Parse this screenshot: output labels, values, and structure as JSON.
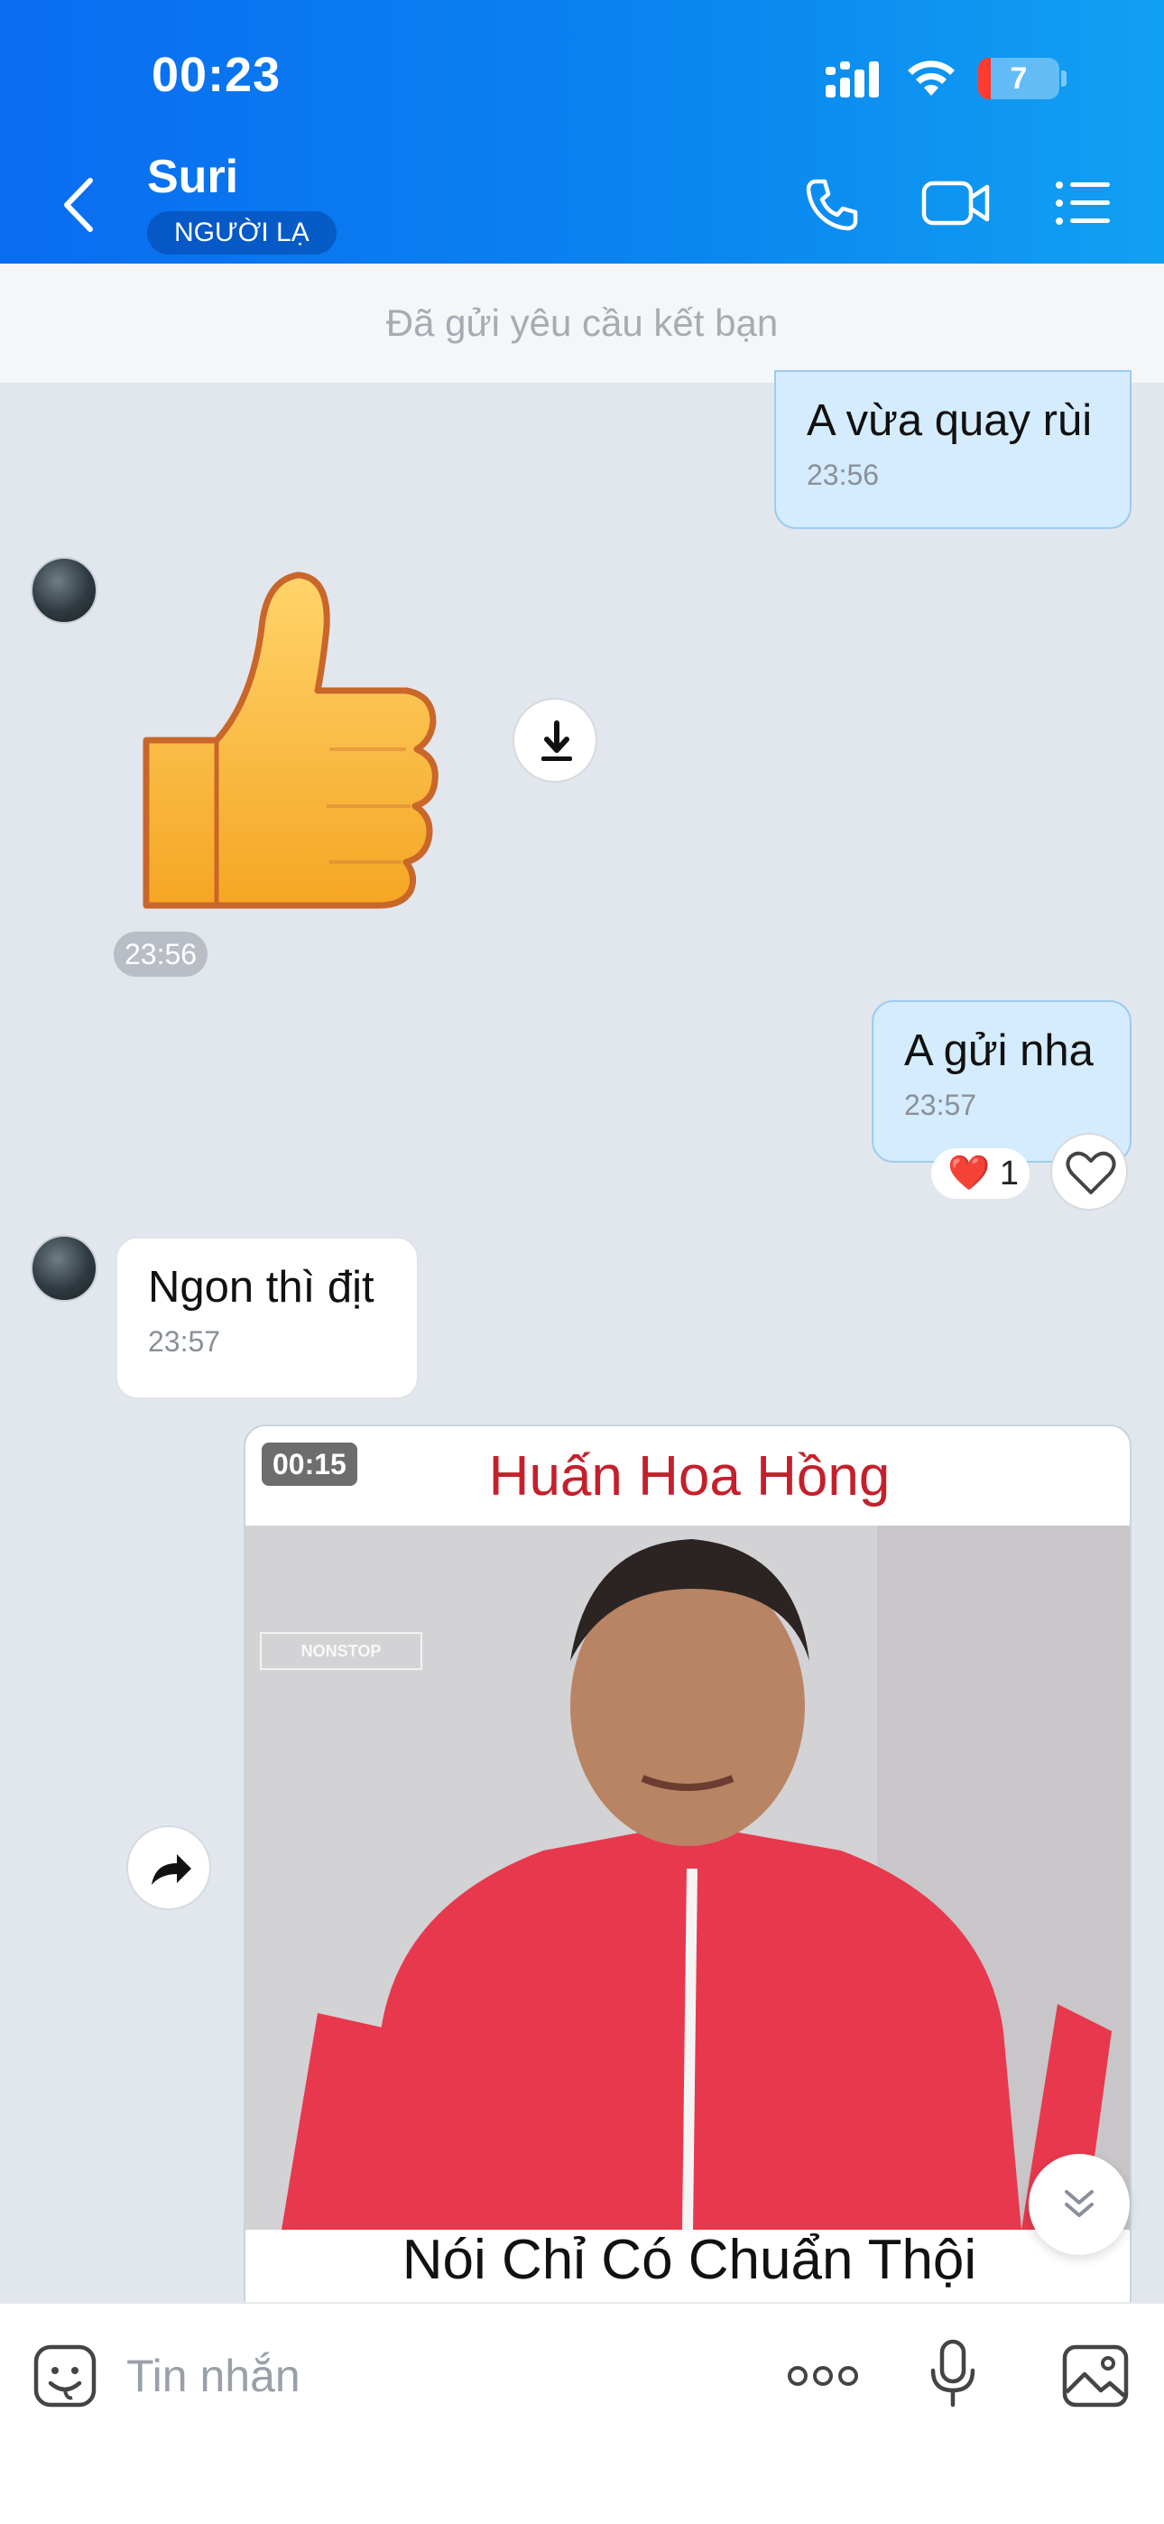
{
  "status_bar": {
    "time": "00:23",
    "battery": "7"
  },
  "header": {
    "name": "Suri",
    "badge": "NGƯỜI LẠ"
  },
  "banner": {
    "text": "Đã gửi yêu cầu kết bạn"
  },
  "messages": [
    {
      "dir": "out",
      "text": "A vừa quay rùi",
      "time": "23:56"
    },
    {
      "dir": "in",
      "type": "sticker",
      "sticker": "thumbs-up",
      "time": "23:56"
    },
    {
      "dir": "out",
      "text": "A gửi nha",
      "time": "23:57",
      "reaction": {
        "emoji": "❤️",
        "count": "1"
      }
    },
    {
      "dir": "in",
      "text": "Ngon thì địt",
      "time": "23:57"
    },
    {
      "dir": "out",
      "type": "video",
      "duration": "00:15",
      "top_title": "Huấn Hoa Hồng",
      "bottom_title": "Nói Chỉ Có Chuẩn Thội"
    }
  ],
  "input": {
    "placeholder": "Tin nhắn"
  },
  "colors": {
    "header_start": "#0a6cf0",
    "header_end": "#12a0f2",
    "out_bubble": "#d4ecfd",
    "chat_bg": "#e2e7ee"
  }
}
